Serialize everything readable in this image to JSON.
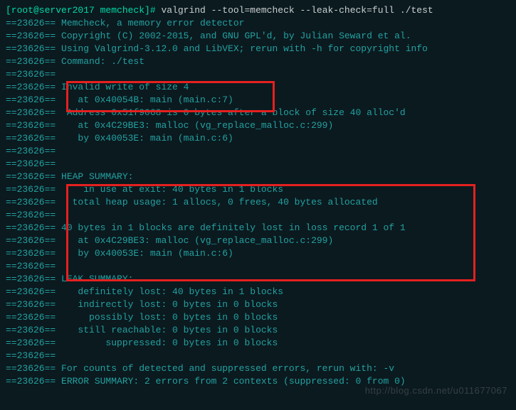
{
  "pid": "==23626==",
  "prompt": {
    "user_host": "[root@server2017 memcheck]#",
    "command": "valgrind --tool=memcheck --leak-check=full ./test"
  },
  "lines": {
    "l0": " Memcheck, a memory error detector",
    "l1": " Copyright (C) 2002-2015, and GNU GPL'd, by Julian Seward et al.",
    "l2": " Using Valgrind-3.12.0 and LibVEX; rerun with -h for copyright info",
    "l3": " Command: ./test",
    "l4": "",
    "l5": " Invalid write of size 4",
    "l6": "    at 0x40054B: main (main.c:7)",
    "l7": "  Address 0x51f9068 is 0 bytes after a block of size 40 alloc'd",
    "l8": "    at 0x4C29BE3: malloc (vg_replace_malloc.c:299)",
    "l9": "    by 0x40053E: main (main.c:6)",
    "l10": "",
    "l11": "",
    "l12": " HEAP SUMMARY:",
    "l13": "     in use at exit: 40 bytes in 1 blocks",
    "l14": "   total heap usage: 1 allocs, 0 frees, 40 bytes allocated",
    "l15": "",
    "l16": " 40 bytes in 1 blocks are definitely lost in loss record 1 of 1",
    "l17": "    at 0x4C29BE3: malloc (vg_replace_malloc.c:299)",
    "l18": "    by 0x40053E: main (main.c:6)",
    "l19": "",
    "l20": " LEAK SUMMARY:",
    "l21": "    definitely lost: 40 bytes in 1 blocks",
    "l22": "    indirectly lost: 0 bytes in 0 blocks",
    "l23": "      possibly lost: 0 bytes in 0 blocks",
    "l24": "    still reachable: 0 bytes in 0 blocks",
    "l25": "         suppressed: 0 bytes in 0 blocks",
    "l26": "",
    "l27": " For counts of detected and suppressed errors, rerun with: -v",
    "l28": " ERROR SUMMARY: 2 errors from 2 contexts (suppressed: 0 from 0)"
  },
  "watermark": "http://blog.csdn.net/u011677067"
}
